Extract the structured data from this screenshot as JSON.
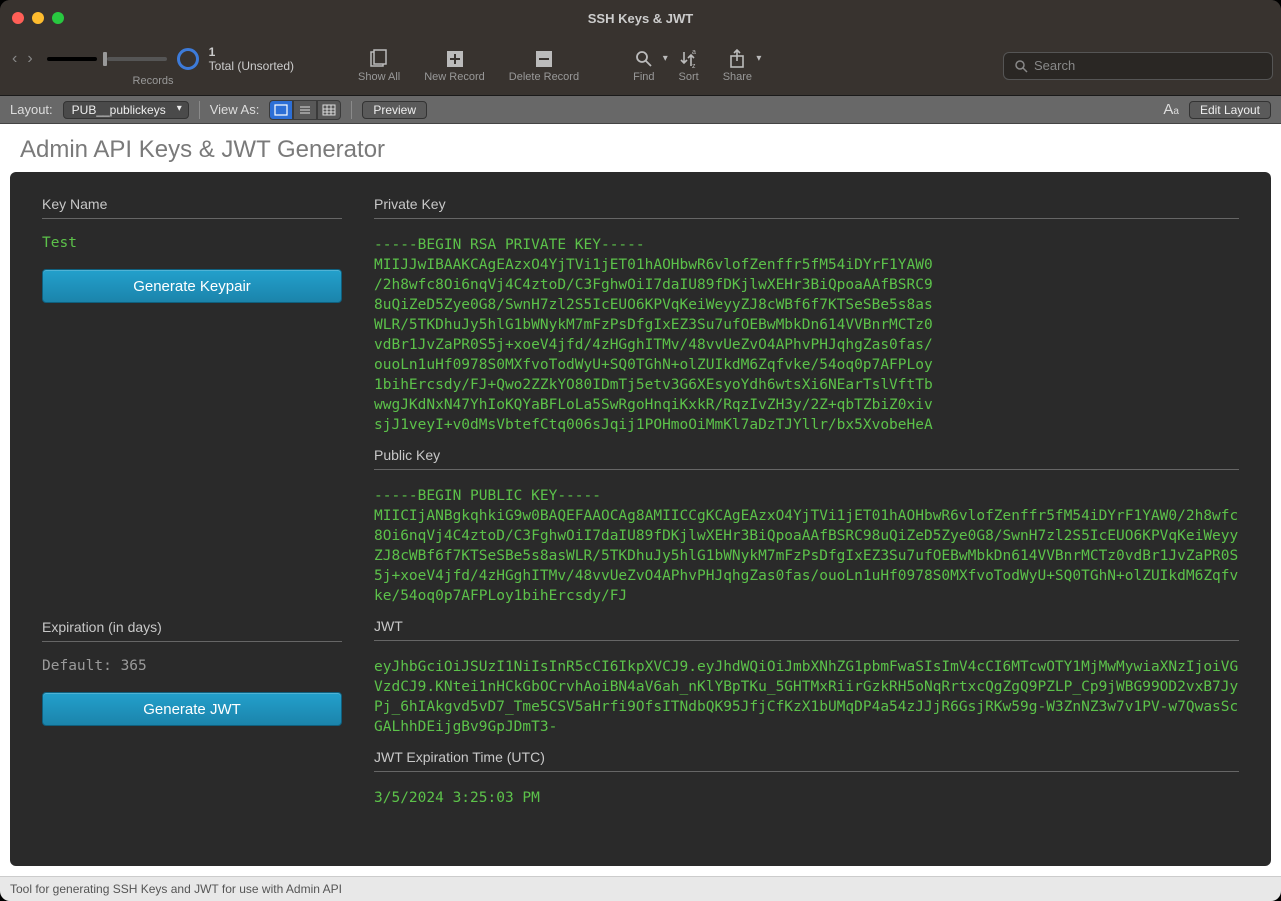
{
  "window": {
    "title": "SSH Keys & JWT"
  },
  "toolbar": {
    "records": {
      "count": "1",
      "status": "Total (Unsorted)",
      "group_label": "Records"
    },
    "show_all": "Show All",
    "new_record": "New Record",
    "delete_record": "Delete Record",
    "find": "Find",
    "sort": "Sort",
    "share": "Share",
    "search_placeholder": "Search"
  },
  "layout_bar": {
    "layout_label": "Layout:",
    "layout_value": "PUB__publickeys",
    "view_as_label": "View As:",
    "preview": "Preview",
    "edit_layout": "Edit Layout"
  },
  "page": {
    "title": "Admin API Keys & JWT Generator"
  },
  "form": {
    "key_name_label": "Key Name",
    "key_name_value": "Test",
    "generate_keypair": "Generate Keypair",
    "expiration_label": "Expiration (in days)",
    "expiration_placeholder": "Default: 365",
    "generate_jwt": "Generate JWT",
    "private_key_label": "Private Key",
    "private_key_value": "-----BEGIN RSA PRIVATE KEY-----\nMIIJJwIBAAKCAgEAzxO4YjTVi1jET01hAOHbwR6vlofZenffr5fM54iDYrF1YAW0\n/2h8wfc8Oi6nqVj4C4ztoD/C3FghwOiI7daIU89fDKjlwXEHr3BiQpoaAAfBSRC9\n8uQiZeD5Zye0G8/SwnH7zl2S5IcEUO6KPVqKeiWeyyZJ8cWBf6f7KTSeSBe5s8as\nWLR/5TKDhuJy5hlG1bWNykM7mFzPsDfgIxEZ3Su7ufOEBwMbkDn614VVBnrMCTz0\nvdBr1JvZaPR0S5j+xoeV4jfd/4zHGghITMv/48vvUeZvO4APhvPHJqhgZas0fas/\nouoLn1uHf0978S0MXfvoTodWyU+SQ0TGhN+olZUIkdM6Zqfvke/54oq0p7AFPLoy\n1bihErcsdy/FJ+Qwo2ZZkYO80IDmTj5etv3G6XEsyoYdh6wtsXi6NEarTslVftTb\nwwgJKdNxN47YhIoKQYaBFLoLa5SwRgoHnqiKxkR/RqzIvZH3y/2Z+qbTZbiZ0xiv\nsjJ1veyI+v0dMsVbtefCtq006sJqij1POHmoOiMmKl7aDzTJYllr/bx5XvobeHeA",
    "public_key_label": "Public Key",
    "public_key_value": "-----BEGIN PUBLIC KEY-----\nMIICIjANBgkqhkiG9w0BAQEFAAOCAg8AMIICCgKCAgEAzxO4YjTVi1jET01hAOHbwR6vlofZenffr5fM54iDYrF1YAW0/2h8wfc8Oi6nqVj4C4ztoD/C3FghwOiI7daIU89fDKjlwXEHr3BiQpoaAAfBSRC98uQiZeD5Zye0G8/SwnH7zl2S5IcEUO6KPVqKeiWeyyZJ8cWBf6f7KTSeSBe5s8asWLR/5TKDhuJy5hlG1bWNykM7mFzPsDfgIxEZ3Su7ufOEBwMbkDn614VVBnrMCTz0vdBr1JvZaPR0S5j+xoeV4jfd/4zHGghITMv/48vvUeZvO4APhvPHJqhgZas0fas/ouoLn1uHf0978S0MXfvoTodWyU+SQ0TGhN+olZUIkdM6Zqfvke/54oq0p7AFPLoy1bihErcsdy/FJ",
    "jwt_label": "JWT",
    "jwt_value": "eyJhbGciOiJSUzI1NiIsInR5cCI6IkpXVCJ9.eyJhdWQiOiJmbXNhZG1pbmFwaSIsImV4cCI6MTcwOTY1MjMwMywiaXNzIjoiVGVzdCJ9.KNtei1nHCkGbOCrvhAoiBN4aV6ah_nKlYBpTKu_5GHTMxRiirGzkRH5oNqRrtxcQgZgQ9PZLP_Cp9jWBG99OD2vxB7JyPj_6hIAkgvd5vD7_Tme5CSV5aHrfi9OfsITNdbQK95JfjCfKzX1bUMqDP4a54zJJjR6GsjRKw59g-W3ZnNZ3w7v1PV-w7QwasScGALhhDEijgBv9GpJDmT3-",
    "jwt_exp_label": "JWT Expiration Time (UTC)",
    "jwt_exp_value": "3/5/2024 3:25:03 PM"
  },
  "status_bar": {
    "text": "Tool for generating SSH Keys and JWT for use with Admin API"
  }
}
